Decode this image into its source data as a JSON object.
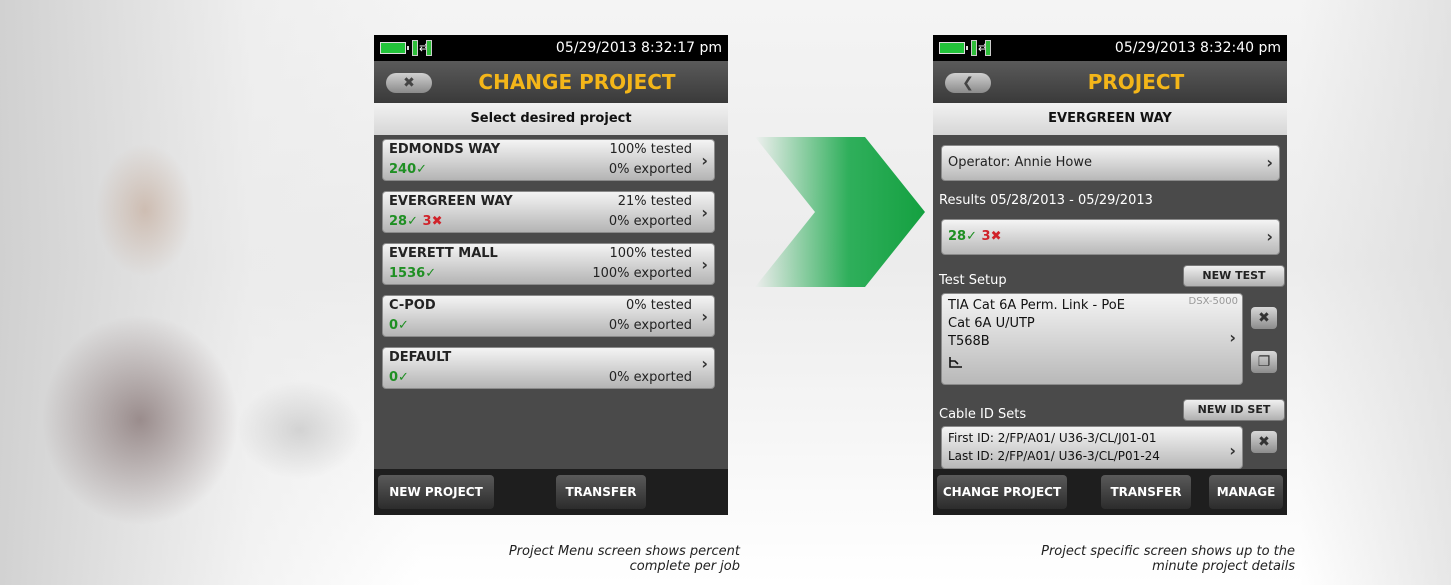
{
  "left_screen": {
    "status": {
      "datetime": "05/29/2013 8:32:17 pm"
    },
    "title": "CHANGE PROJECT",
    "subheader": "Select desired project",
    "projects": [
      {
        "name": "EDMONDS WAY",
        "tested": "100% tested",
        "exported": "0% exported",
        "pass": "240",
        "fail": ""
      },
      {
        "name": "EVERGREEN WAY",
        "tested": "21% tested",
        "exported": "0% exported",
        "pass": "28",
        "fail": "3"
      },
      {
        "name": "EVERETT MALL",
        "tested": "100% tested",
        "exported": "100% exported",
        "pass": "1536",
        "fail": ""
      },
      {
        "name": "C-POD",
        "tested": "0% tested",
        "exported": "0% exported",
        "pass": "0",
        "fail": ""
      },
      {
        "name": "DEFAULT",
        "tested": "",
        "exported": "0% exported",
        "pass": "0",
        "fail": ""
      }
    ],
    "buttons": {
      "new_project": "NEW PROJECT",
      "transfer": "TRANSFER"
    }
  },
  "right_screen": {
    "status": {
      "datetime": "05/29/2013 8:32:40 pm"
    },
    "title": "PROJECT",
    "subheader": "EVERGREEN WAY",
    "operator": "Operator: Annie Howe",
    "results_label": "Results 05/28/2013 - 05/29/2013",
    "results": {
      "pass": "28",
      "fail": "3"
    },
    "test_setup": {
      "label": "Test Setup",
      "new_test": "NEW TEST",
      "line1": "TIA Cat 6A Perm. Link - PoE",
      "line2": "Cat 6A U/UTP",
      "line3": "T568B",
      "device": "DSX-5000"
    },
    "cable_id": {
      "label": "Cable ID Sets",
      "new_id_set": "NEW ID SET",
      "first": "First ID: 2/FP/A01/ U36-3/CL/J01-01",
      "last": "Last ID: 2/FP/A01/ U36-3/CL/P01-24"
    },
    "buttons": {
      "change_project": "CHANGE PROJECT",
      "transfer": "TRANSFER",
      "manage": "MANAGE"
    }
  },
  "captions": {
    "left_line1": "Project Menu screen shows percent",
    "left_line2": "complete per job",
    "right_line1": "Project specific screen shows up to the",
    "right_line2": "minute project details"
  },
  "glyphs": {
    "check": "✓",
    "cross": "✖",
    "chevron": "›",
    "back": "✖",
    "back_arrow": "❮",
    "close": "✖",
    "copy": "❐"
  },
  "colors": {
    "title": "#f4b619",
    "pass": "#1f8f23",
    "fail": "#d0232a",
    "arrow": "#1aa84b",
    "battery": "#22c43a"
  }
}
